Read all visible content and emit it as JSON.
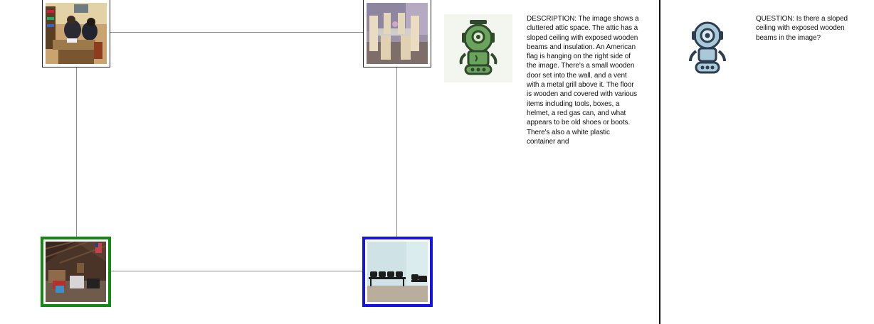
{
  "graph": {
    "nodes": [
      {
        "id": "top-left",
        "scene": "people working at desks in a cluttered room"
      },
      {
        "id": "top-right",
        "scene": "dining table with chairs"
      },
      {
        "id": "bottom-left",
        "scene": "cluttered attic with sloped ceiling and flag",
        "highlight": "green"
      },
      {
        "id": "bottom-right",
        "scene": "waiting room with row of black chairs",
        "highlight": "blue"
      }
    ],
    "edges": [
      [
        "top-left",
        "top-right"
      ],
      [
        "top-left",
        "bottom-left"
      ],
      [
        "top-right",
        "bottom-right"
      ],
      [
        "bottom-left",
        "bottom-right"
      ]
    ],
    "colors": {
      "edge": "#8a8a8a",
      "green_highlight": "#128a12",
      "blue_highlight": "#1414e6"
    }
  },
  "describer": {
    "icon": "green-robot-icon",
    "text": "DESCRIPTION: The image shows a cluttered attic space. The attic has a sloped ceiling with exposed wooden beams and insulation. An American flag is hanging on the right side of the image. There's a small wooden door set into the wall, and a vent with a metal grill above it. The floor is wooden and covered with various items including tools, boxes, a helmet, a red gas can, and what appears to be old shoes or boots. There's also a white plastic container and"
  },
  "questioner": {
    "icon": "blue-robot-icon",
    "text": "QUESTION: Is there a sloped ceiling with exposed wooden beams in the image?"
  }
}
